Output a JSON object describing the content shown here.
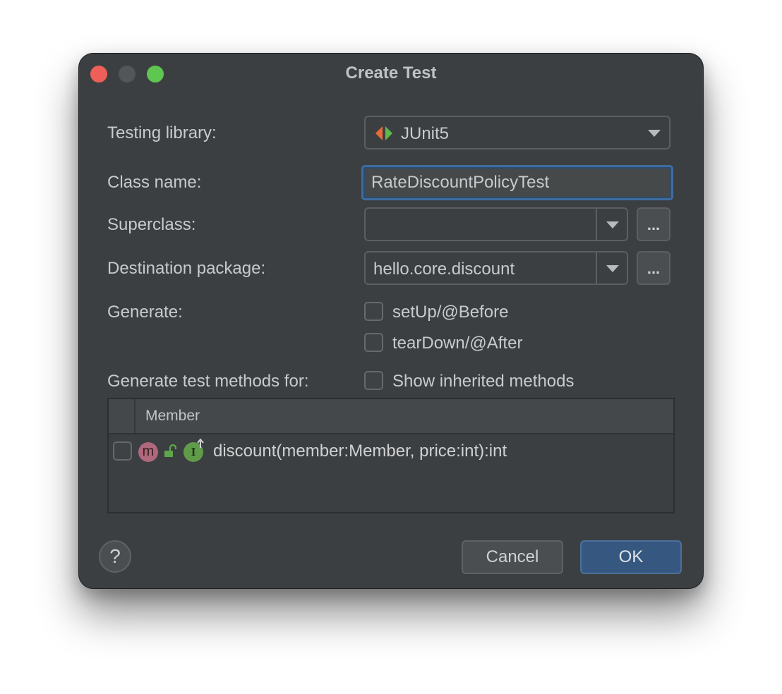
{
  "window": {
    "title": "Create Test"
  },
  "form": {
    "testing_library": {
      "label": "Testing library:",
      "value": "JUnit5",
      "icon": "junit-icon"
    },
    "class_name": {
      "label": "Class name:",
      "value": "RateDiscountPolicyTest"
    },
    "superclass": {
      "label": "Superclass:",
      "value": "",
      "browse": "..."
    },
    "destination_package": {
      "label": "Destination package:",
      "value": "hello.core.discount",
      "browse": "..."
    },
    "generate": {
      "label": "Generate:",
      "options": [
        {
          "label": "setUp/@Before",
          "checked": false
        },
        {
          "label": "tearDown/@After",
          "checked": false
        }
      ]
    },
    "methods": {
      "label": "Generate test methods for:",
      "show_inherited": {
        "label": "Show inherited methods",
        "checked": false
      }
    }
  },
  "table": {
    "column": "Member",
    "rows": [
      {
        "text": "discount(member:Member, price:int):int",
        "checked": false,
        "badge_method": "m",
        "badge_interface": "I"
      }
    ]
  },
  "footer": {
    "help": "?",
    "cancel": "Cancel",
    "ok": "OK"
  },
  "colors": {
    "background": "#3c3f41",
    "accent": "#365880",
    "focus": "#3f6ca0",
    "method_badge": "#b0687c",
    "interface_badge": "#609b4a",
    "junit_left": "#e8693a",
    "junit_right": "#5fb84a"
  }
}
